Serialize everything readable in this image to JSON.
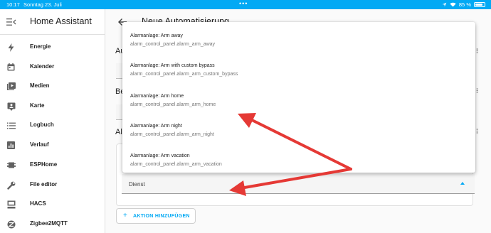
{
  "status_bar": {
    "time": "10:17",
    "date": "Sonntag 23. Juli",
    "dots": "•••",
    "battery": "85 %",
    "battery_level": 0.85
  },
  "sidebar": {
    "title": "Home Assistant",
    "items": [
      {
        "label": "Energie",
        "icon": "lightning-icon"
      },
      {
        "label": "Kalender",
        "icon": "calendar-icon"
      },
      {
        "label": "Medien",
        "icon": "media-icon"
      },
      {
        "label": "Karte",
        "icon": "map-icon"
      },
      {
        "label": "Logbuch",
        "icon": "logbook-icon"
      },
      {
        "label": "Verlauf",
        "icon": "history-icon"
      },
      {
        "label": "ESPHome",
        "icon": "esphome-icon"
      },
      {
        "label": "File editor",
        "icon": "wrench-icon"
      },
      {
        "label": "HACS",
        "icon": "hacs-icon"
      },
      {
        "label": "Zigbee2MQTT",
        "icon": "zigbee-icon"
      }
    ]
  },
  "header": {
    "title": "Neue Automatisierung"
  },
  "sections": {
    "s1_letters": "Au",
    "s2_letters": "Be",
    "s3_letters": "Al"
  },
  "action_card": {
    "dienst_label": "Dienst"
  },
  "add_action_button": {
    "plus": "+",
    "label": "AKTION HINZUFÜGEN"
  },
  "dropdown": {
    "items": [
      {
        "title": "Alarmanlage: Arm away",
        "service": "alarm_control_panel.alarm_arm_away"
      },
      {
        "title": "Alarmanlage: Arm with custom bypass",
        "service": "alarm_control_panel.alarm_arm_custom_bypass"
      },
      {
        "title": "Alarmanlage: Arm home",
        "service": "alarm_control_panel.alarm_arm_home"
      },
      {
        "title": "Alarmanlage: Arm night",
        "service": "alarm_control_panel.alarm_arm_night"
      },
      {
        "title": "Alarmanlage: Arm vacation",
        "service": "alarm_control_panel.alarm_arm_vacation"
      }
    ]
  },
  "colors": {
    "accent": "#03a9f4",
    "annotation_arrow": "#e53935"
  }
}
